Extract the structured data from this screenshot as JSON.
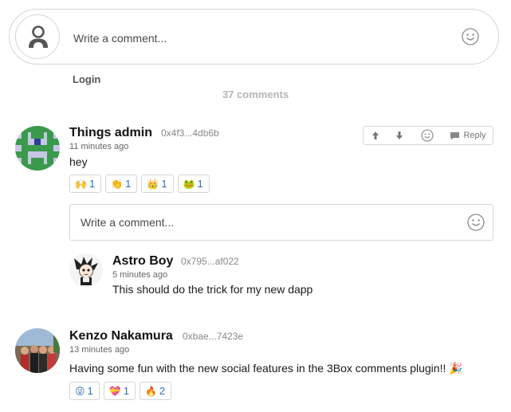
{
  "composer": {
    "placeholder": "Write a comment...",
    "login_label": "Login",
    "count_label": "37 comments"
  },
  "comments": [
    {
      "author": "Things admin",
      "address": "0x4f3...4db6b",
      "time": "11 minutes ago",
      "text": "hey",
      "reactions": [
        {
          "emoji": "🙌",
          "count": "1"
        },
        {
          "emoji": "👏",
          "count": "1"
        },
        {
          "emoji": "👑",
          "count": "1"
        },
        {
          "emoji": "🐸",
          "count": "1"
        }
      ],
      "toolbar": {
        "reply_label": "Reply"
      },
      "reply_box": {
        "placeholder": "Write a comment..."
      },
      "replies": [
        {
          "author": "Astro Boy",
          "address": "0x795...af022",
          "time": "5 minutes ago",
          "text": "This should do the trick for my new dapp"
        }
      ]
    },
    {
      "author": "Kenzo Nakamura",
      "address": "0xbae...7423e",
      "time": "13 minutes ago",
      "text": "Having some fun with the new social features in the 3Box comments plugin!! 🎉",
      "reactions": [
        {
          "emoji": "😜",
          "count": "1"
        },
        {
          "emoji": "💝",
          "count": "1"
        },
        {
          "emoji": "🔥",
          "count": "2"
        }
      ]
    }
  ],
  "colors": {
    "reaction_count": "#2d6fb5",
    "border": "#d6d6d6",
    "muted": "#b5b5b5"
  },
  "icons": {
    "user": "user-icon",
    "smiley": "smiley-icon",
    "upvote": "arrow-up-icon",
    "downvote": "arrow-down-icon",
    "reply": "reply-icon"
  }
}
